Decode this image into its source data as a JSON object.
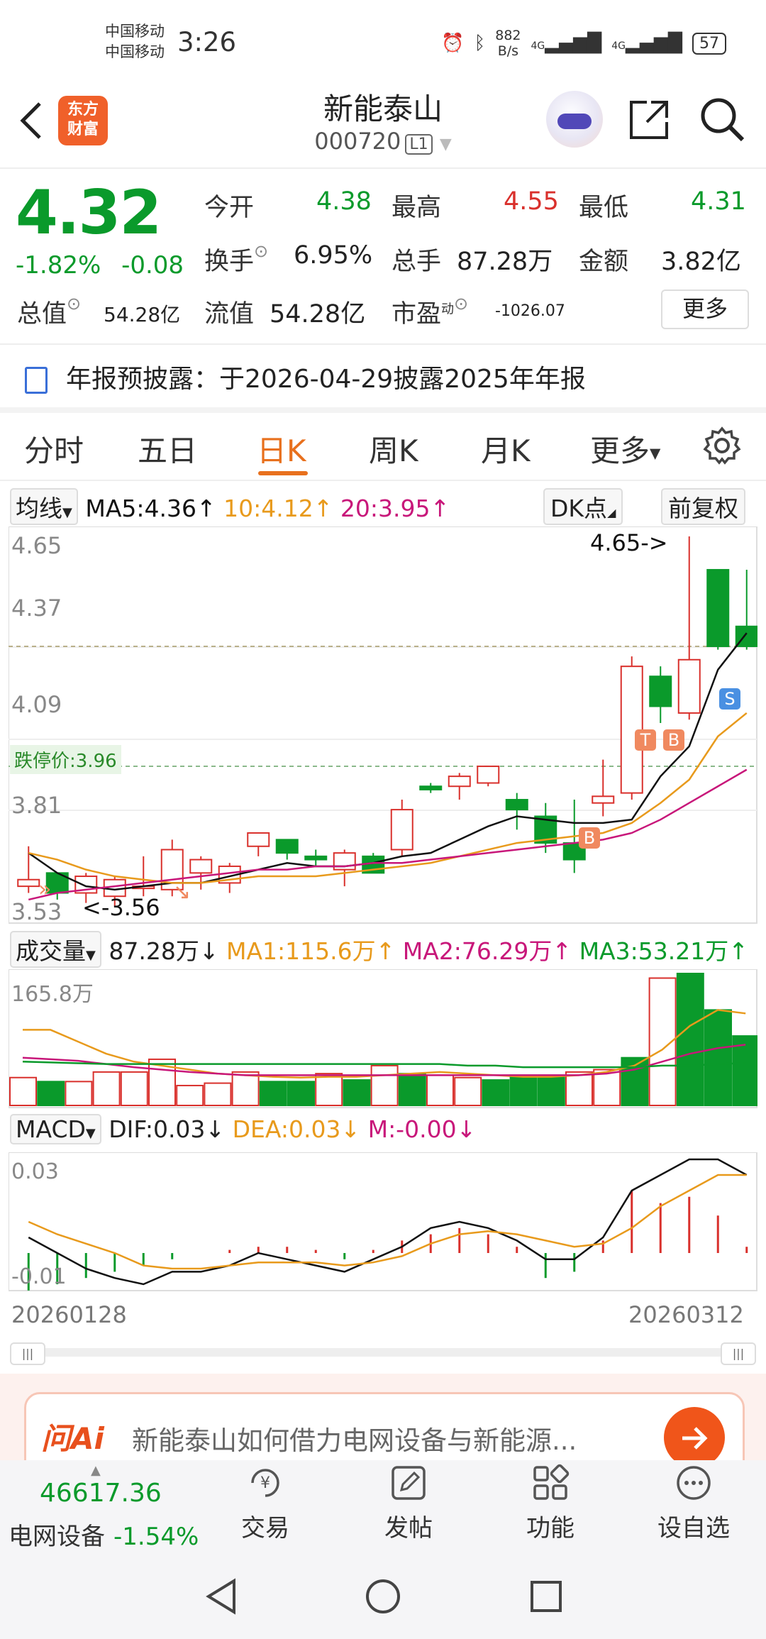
{
  "status_bar": {
    "carrier1": "中国移动",
    "carrier2": "中国移动",
    "time": "3:26",
    "net_speed_value": "882",
    "net_speed_unit": "B/s",
    "signal1": "4G",
    "signal2": "4G",
    "battery": "57"
  },
  "header": {
    "logo_line1": "东方",
    "logo_line2": "财富",
    "title": "新能泰山",
    "code": "000720",
    "level": "L1"
  },
  "quote": {
    "price": "4.32",
    "change_pct": "-1.82%",
    "change": "-0.08",
    "open_label": "今开",
    "open": "4.38",
    "high_label": "最高",
    "high": "4.55",
    "low_label": "最低",
    "low": "4.31",
    "turnover_label": "换手",
    "turnover": "6.95%",
    "volume_label": "总手",
    "volume": "87.28万",
    "amount_label": "金额",
    "amount": "3.82亿",
    "mktcap_label": "总值",
    "mktcap": "54.28亿",
    "float_label": "流值",
    "float_cap": "54.28亿",
    "pe_label": "市盈",
    "pe_sup": "动",
    "pe": "-1026.07",
    "more_label": "更多"
  },
  "report": {
    "text": "年报预披露：于2026-04-29披露2025年年报"
  },
  "tabs": [
    {
      "label": "分时"
    },
    {
      "label": "五日"
    },
    {
      "label": "日K"
    },
    {
      "label": "周K"
    },
    {
      "label": "月K"
    },
    {
      "label": "更多"
    }
  ],
  "active_tab": "日K",
  "kline_legend": {
    "selector": "均线",
    "ma5": "MA5:4.36↑",
    "ma10": "10:4.12↑",
    "ma20": "20:3.95↑",
    "dk_button": "DK点",
    "adjust_button": "前复权"
  },
  "kline_axis": {
    "y1": "4.65",
    "y2": "4.37",
    "y3": "4.09",
    "y4": "3.81",
    "y5": "3.53",
    "limit_down": "跌停价:3.96",
    "max_label": "4.65->",
    "min_label": "<-3.56"
  },
  "signals": {
    "t": "T",
    "b": "B",
    "s": "S"
  },
  "volume_legend": {
    "selector": "成交量",
    "vol": "87.28万↓",
    "ma1": "MA1:115.6万↑",
    "ma2": "MA2:76.29万↑",
    "ma3": "MA3:53.21万↑",
    "axis_max": "165.8万"
  },
  "macd_legend": {
    "selector": "MACD",
    "dif": "DIF:0.03↓",
    "dea": "DEA:0.03↓",
    "m": "M:-0.00↓",
    "axis_top": "0.03",
    "axis_bottom": "-0.01"
  },
  "date_range": {
    "start": "20260128",
    "end": "20260312"
  },
  "ask_ai": {
    "brand": "问Ai",
    "text": "新能泰山如何借力电网设备与新能源..."
  },
  "bottom_bar": {
    "index_value": "46617.36",
    "index_name": "电网设备",
    "index_change": "-1.54%",
    "trade": "交易",
    "post": "发帖",
    "function": "功能",
    "watchlist": "设自选"
  },
  "colors": {
    "up": "#d9302c",
    "down": "#0a9a2b",
    "ma5": "#111111",
    "ma10": "#e89a1c",
    "ma20": "#c8177a",
    "accent": "#e8701d"
  },
  "chart_data": {
    "type": "candlestick",
    "dates_start": "20260128",
    "dates_end": "20260312",
    "candles": [
      {
        "o": 3.6,
        "h": 3.72,
        "l": 3.58,
        "c": 3.62
      },
      {
        "o": 3.64,
        "h": 3.64,
        "l": 3.56,
        "c": 3.58
      },
      {
        "o": 3.58,
        "h": 3.64,
        "l": 3.55,
        "c": 3.63
      },
      {
        "o": 3.57,
        "h": 3.63,
        "l": 3.54,
        "c": 3.62
      },
      {
        "o": 3.6,
        "h": 3.69,
        "l": 3.57,
        "c": 3.6
      },
      {
        "o": 3.59,
        "h": 3.74,
        "l": 3.57,
        "c": 3.71
      },
      {
        "o": 3.64,
        "h": 3.69,
        "l": 3.59,
        "c": 3.68
      },
      {
        "o": 3.61,
        "h": 3.67,
        "l": 3.58,
        "c": 3.66
      },
      {
        "o": 3.72,
        "h": 3.75,
        "l": 3.69,
        "c": 3.76
      },
      {
        "o": 3.74,
        "h": 3.74,
        "l": 3.68,
        "c": 3.7
      },
      {
        "o": 3.69,
        "h": 3.71,
        "l": 3.66,
        "c": 3.68
      },
      {
        "o": 3.65,
        "h": 3.71,
        "l": 3.6,
        "c": 3.7
      },
      {
        "o": 3.69,
        "h": 3.7,
        "l": 3.64,
        "c": 3.64
      },
      {
        "o": 3.71,
        "h": 3.86,
        "l": 3.69,
        "c": 3.83
      },
      {
        "o": 3.9,
        "h": 3.91,
        "l": 3.88,
        "c": 3.89
      },
      {
        "o": 3.9,
        "h": 3.94,
        "l": 3.86,
        "c": 3.93
      },
      {
        "o": 3.91,
        "h": 3.96,
        "l": 3.9,
        "c": 3.96
      },
      {
        "o": 3.86,
        "h": 3.88,
        "l": 3.77,
        "c": 3.83
      },
      {
        "o": 3.81,
        "h": 3.85,
        "l": 3.7,
        "c": 3.73
      },
      {
        "o": 3.73,
        "h": 3.86,
        "l": 3.64,
        "c": 3.68
      },
      {
        "o": 3.85,
        "h": 3.98,
        "l": 3.81,
        "c": 3.87
      },
      {
        "o": 3.88,
        "h": 4.29,
        "l": 3.86,
        "c": 4.26
      },
      {
        "o": 4.23,
        "h": 4.26,
        "l": 4.09,
        "c": 4.14
      },
      {
        "o": 4.12,
        "h": 4.65,
        "l": 4.1,
        "c": 4.28
      },
      {
        "o": 4.55,
        "h": 4.55,
        "l": 4.31,
        "c": 4.32
      },
      {
        "o": 4.38,
        "h": 4.55,
        "l": 4.31,
        "c": 4.32
      }
    ],
    "candles_note": "",
    "ma5": [
      3.7,
      3.64,
      3.6,
      3.59,
      3.6,
      3.61,
      3.61,
      3.63,
      3.65,
      3.67,
      3.66,
      3.66,
      3.67,
      3.69,
      3.7,
      3.74,
      3.78,
      3.81,
      3.8,
      3.79,
      3.79,
      3.8,
      3.93,
      4.02,
      4.25,
      4.36
    ],
    "ma10": [
      3.7,
      3.68,
      3.65,
      3.63,
      3.62,
      3.61,
      3.61,
      3.62,
      3.63,
      3.63,
      3.63,
      3.64,
      3.65,
      3.66,
      3.67,
      3.69,
      3.71,
      3.73,
      3.74,
      3.75,
      3.76,
      3.79,
      3.85,
      3.92,
      4.05,
      4.12
    ],
    "ma20": [
      3.56,
      3.58,
      3.59,
      3.6,
      3.61,
      3.62,
      3.63,
      3.64,
      3.65,
      3.65,
      3.66,
      3.66,
      3.67,
      3.67,
      3.68,
      3.69,
      3.7,
      3.71,
      3.72,
      3.73,
      3.74,
      3.76,
      3.8,
      3.85,
      3.9,
      3.95
    ],
    "volume": [
      35,
      30,
      30,
      42,
      42,
      58,
      25,
      28,
      42,
      30,
      30,
      40,
      32,
      50,
      40,
      38,
      35,
      32,
      38,
      38,
      42,
      45,
      60,
      160,
      165.8,
      120,
      87.28
    ],
    "volume_unit": "万",
    "vol_ma1": [
      95,
      95,
      80,
      65,
      55,
      50,
      45,
      40,
      38,
      36,
      35,
      36,
      36,
      38,
      40,
      42,
      40,
      38,
      36,
      36,
      38,
      42,
      50,
      70,
      100,
      120,
      115.6
    ],
    "vol_ma2": [
      60,
      58,
      56,
      52,
      48,
      45,
      42,
      40,
      38,
      38,
      38,
      38,
      38,
      38,
      38,
      38,
      38,
      38,
      38,
      38,
      38,
      40,
      45,
      55,
      65,
      72,
      76.29
    ],
    "vol_ma3": [
      55,
      54,
      53,
      52,
      52,
      52,
      52,
      52,
      52,
      52,
      52,
      52,
      52,
      52,
      52,
      52,
      50,
      50,
      48,
      48,
      48,
      48,
      48,
      50,
      50,
      52,
      53.21
    ],
    "macd_dif": [
      0.005,
      0.0,
      -0.005,
      -0.008,
      -0.01,
      -0.006,
      -0.006,
      -0.004,
      0.0,
      -0.002,
      -0.004,
      -0.006,
      -0.002,
      0.002,
      0.008,
      0.01,
      0.008,
      0.004,
      -0.002,
      -0.002,
      0.005,
      0.02,
      0.025,
      0.03,
      0.03,
      0.025
    ],
    "macd_dea": [
      0.01,
      0.006,
      0.003,
      0.0,
      -0.004,
      -0.005,
      -0.005,
      -0.004,
      -0.003,
      -0.003,
      -0.003,
      -0.004,
      -0.003,
      -0.001,
      0.003,
      0.006,
      0.007,
      0.006,
      0.004,
      0.002,
      0.003,
      0.008,
      0.015,
      0.02,
      0.025,
      0.025
    ],
    "macd_m": [
      -0.012,
      -0.01,
      -0.008,
      -0.006,
      -0.004,
      -0.002,
      0.0,
      0.001,
      0.002,
      0.002,
      0.001,
      -0.002,
      0.001,
      0.004,
      0.006,
      0.008,
      0.006,
      0.002,
      -0.008,
      -0.006,
      0.004,
      0.02,
      0.016,
      0.018,
      0.012,
      0.002
    ],
    "ylim_price": [
      3.53,
      4.65
    ],
    "ylim_volume": [
      0,
      165.8
    ],
    "ylim_macd": [
      -0.01,
      0.03
    ]
  }
}
